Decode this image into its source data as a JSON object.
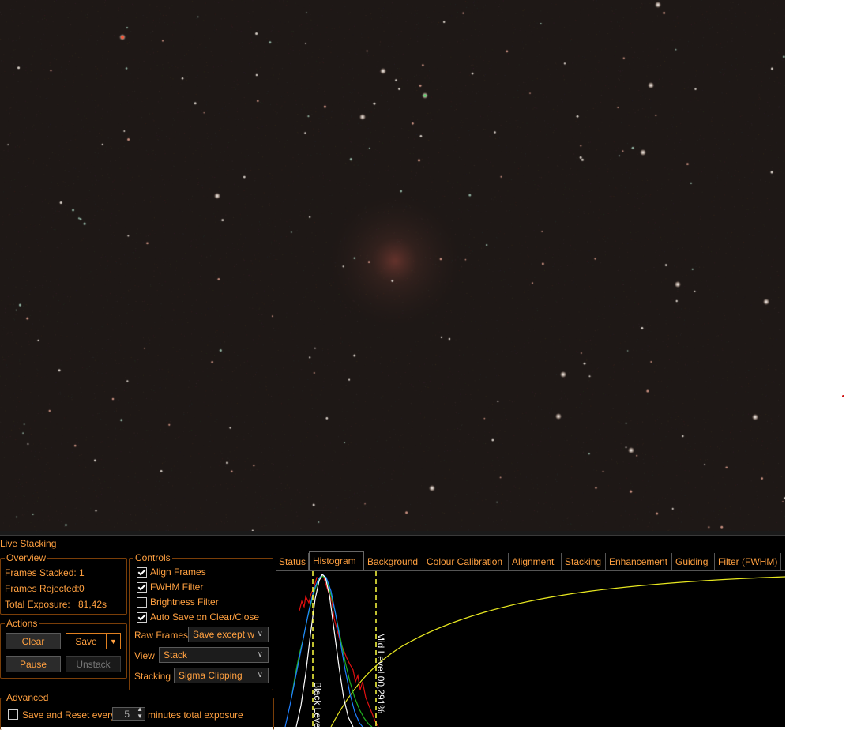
{
  "colors": {
    "accent": "#ffa040",
    "border": "#7a3e08",
    "background": "#000000"
  },
  "image": {
    "description": "stacked-deep-sky-image"
  },
  "panel": {
    "title": "Live Stacking",
    "overview": {
      "legend": "Overview",
      "frames_stacked_label": "Frames Stacked:",
      "frames_stacked_value": "1",
      "frames_rejected_label": "Frames Rejected:",
      "frames_rejected_value": "0",
      "total_exposure_label": "Total Exposure:",
      "total_exposure_value": "81,42s"
    },
    "actions": {
      "legend": "Actions",
      "clear": "Clear",
      "save": "Save",
      "save_dropdown_icon": "chevron-down-icon",
      "pause": "Pause",
      "unstack": "Unstack"
    },
    "controls": {
      "legend": "Controls",
      "align_frames": {
        "label": "Align Frames",
        "checked": true
      },
      "fwhm_filter": {
        "label": "FWHM Filter",
        "checked": true
      },
      "brightness_filter": {
        "label": "Brightness Filter",
        "checked": false
      },
      "auto_save": {
        "label": "Auto Save on Clear/Close",
        "checked": true
      },
      "raw_frames_label": "Raw Frames",
      "raw_frames_value": "Save except w",
      "view_label": "View",
      "view_value": "Stack",
      "stacking_label": "Stacking",
      "stacking_value": "Sigma Clipping"
    },
    "advanced": {
      "legend": "Advanced",
      "save_reset": {
        "label": "Save and Reset every",
        "checked": false
      },
      "minutes_value": "5",
      "minutes_suffix": "minutes total exposure"
    },
    "tabs": [
      {
        "label": "Status",
        "active": false
      },
      {
        "label": "Histogram",
        "active": true
      },
      {
        "label": "Background",
        "active": false
      },
      {
        "label": "Colour Calibration",
        "active": false
      },
      {
        "label": "Alignment",
        "active": false
      },
      {
        "label": "Stacking",
        "active": false
      },
      {
        "label": "Enhancement",
        "active": false
      },
      {
        "label": "Guiding",
        "active": false
      },
      {
        "label": "Filter (FWHM)",
        "active": false
      }
    ],
    "histogram": {
      "black_level_label": "Black Level",
      "mid_level_label": "Mid Level 00,291%"
    }
  }
}
